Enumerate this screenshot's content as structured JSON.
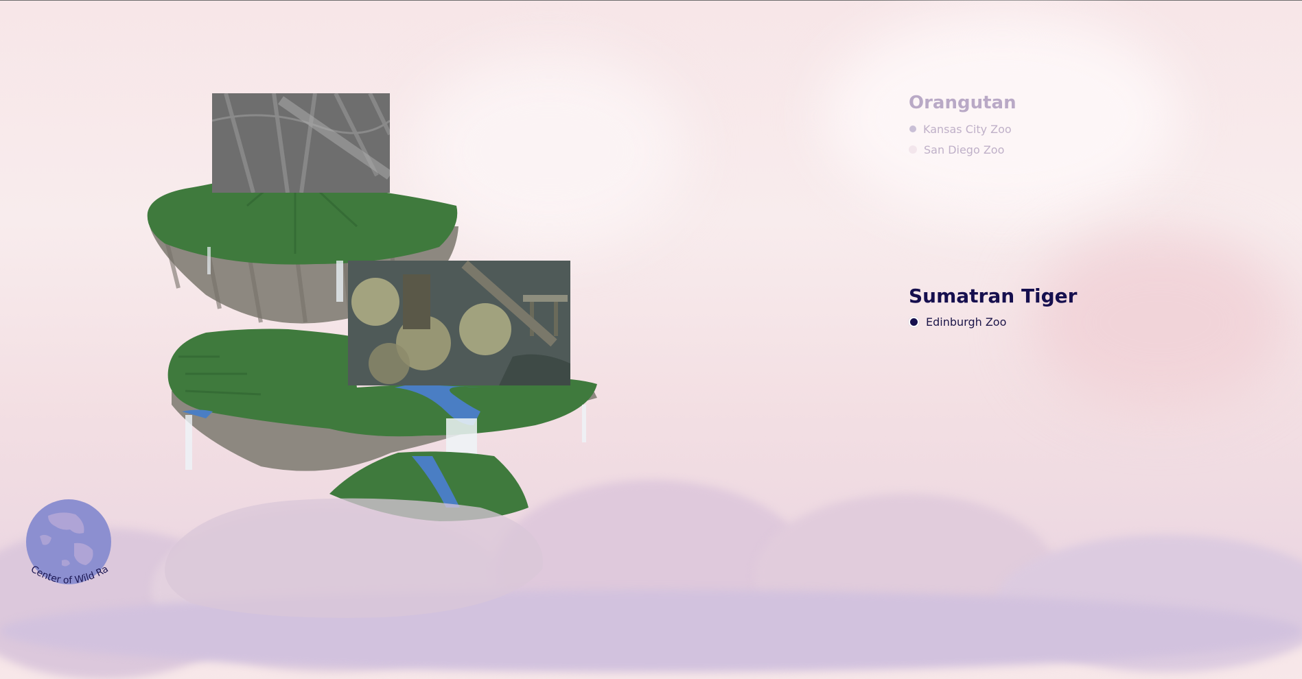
{
  "species": [
    {
      "name": "Orangutan",
      "zoos": [
        {
          "label": "Kansas City Zoo",
          "selected": true
        },
        {
          "label": "San Diego Zoo",
          "selected": false
        }
      ]
    },
    {
      "name": "Sumatran Tiger",
      "zoos": [
        {
          "label": "Edinburgh Zoo",
          "selected": true
        }
      ]
    }
  ],
  "globe": {
    "caption": "Center of Wild Range"
  },
  "colors": {
    "active_title": "#160f4e",
    "inactive_title": "#b9a9c6",
    "grass": "#3f7a3d",
    "rock": "#8d8880",
    "water": "#4a7ec4",
    "globe": "#8c8fd0"
  },
  "icons": [
    "globe-icon",
    "radio-dot-icon"
  ]
}
